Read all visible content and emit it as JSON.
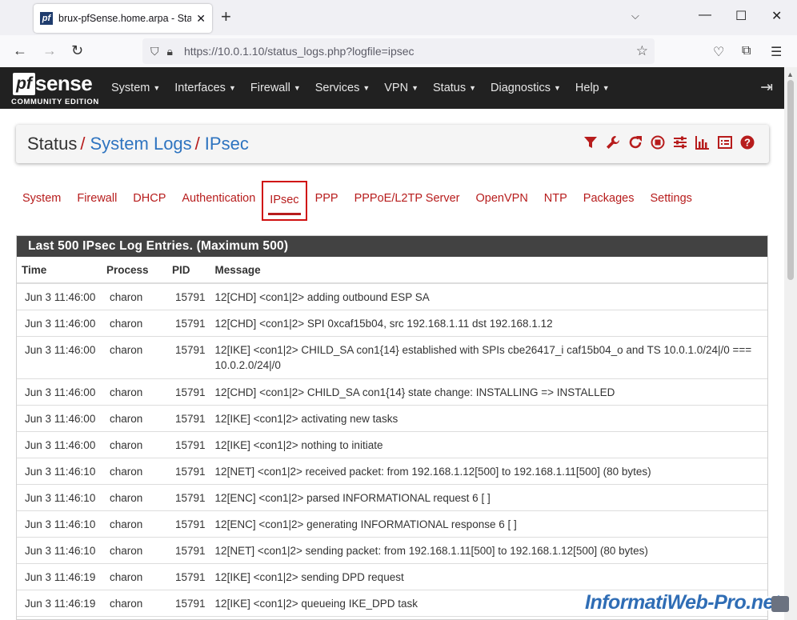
{
  "browser": {
    "tab_title": "brux-pfSense.home.arpa - Status",
    "url_host": "https://10.0.1.10",
    "url_path": "/status_logs.php?logfile=ipsec"
  },
  "nav": {
    "logo_pf": "pf",
    "logo_sense": "sense",
    "logo_edition": "COMMUNITY EDITION",
    "menu": [
      "System",
      "Interfaces",
      "Firewall",
      "Services",
      "VPN",
      "Status",
      "Diagnostics",
      "Help"
    ]
  },
  "breadcrumb": {
    "root": "Status",
    "sep": "/",
    "level1": "System Logs",
    "level2": "IPsec"
  },
  "log_tabs": [
    "System",
    "Firewall",
    "DHCP",
    "Authentication",
    "IPsec",
    "PPP",
    "PPPoE/L2TP Server",
    "OpenVPN",
    "NTP",
    "Packages",
    "Settings"
  ],
  "active_tab": "IPsec",
  "panel": {
    "heading": "Last 500 IPsec Log Entries. (Maximum 500)",
    "columns": [
      "Time",
      "Process",
      "PID",
      "Message"
    ],
    "rows": [
      {
        "time": "Jun 3 11:46:00",
        "process": "charon",
        "pid": "15791",
        "message": "12[CHD] <con1|2> adding outbound ESP SA"
      },
      {
        "time": "Jun 3 11:46:00",
        "process": "charon",
        "pid": "15791",
        "message": "12[CHD] <con1|2> SPI 0xcaf15b04, src 192.168.1.11 dst 192.168.1.12"
      },
      {
        "time": "Jun 3 11:46:00",
        "process": "charon",
        "pid": "15791",
        "message": "12[IKE] <con1|2> CHILD_SA con1{14} established with SPIs cbe26417_i caf15b04_o and TS 10.0.1.0/24|/0 === 10.0.2.0/24|/0"
      },
      {
        "time": "Jun 3 11:46:00",
        "process": "charon",
        "pid": "15791",
        "message": "12[CHD] <con1|2> CHILD_SA con1{14} state change: INSTALLING => INSTALLED"
      },
      {
        "time": "Jun 3 11:46:00",
        "process": "charon",
        "pid": "15791",
        "message": "12[IKE] <con1|2> activating new tasks"
      },
      {
        "time": "Jun 3 11:46:00",
        "process": "charon",
        "pid": "15791",
        "message": "12[IKE] <con1|2> nothing to initiate"
      },
      {
        "time": "Jun 3 11:46:10",
        "process": "charon",
        "pid": "15791",
        "message": "12[NET] <con1|2> received packet: from 192.168.1.12[500] to 192.168.1.11[500] (80 bytes)"
      },
      {
        "time": "Jun 3 11:46:10",
        "process": "charon",
        "pid": "15791",
        "message": "12[ENC] <con1|2> parsed INFORMATIONAL request 6 [ ]"
      },
      {
        "time": "Jun 3 11:46:10",
        "process": "charon",
        "pid": "15791",
        "message": "12[ENC] <con1|2> generating INFORMATIONAL response 6 [ ]"
      },
      {
        "time": "Jun 3 11:46:10",
        "process": "charon",
        "pid": "15791",
        "message": "12[NET] <con1|2> sending packet: from 192.168.1.11[500] to 192.168.1.12[500] (80 bytes)"
      },
      {
        "time": "Jun 3 11:46:19",
        "process": "charon",
        "pid": "15791",
        "message": "12[IKE] <con1|2> sending DPD request"
      },
      {
        "time": "Jun 3 11:46:19",
        "process": "charon",
        "pid": "15791",
        "message": "12[IKE] <con1|2> queueing IKE_DPD task"
      }
    ]
  },
  "watermark": "InformatiWeb-Pro.net",
  "icons": [
    "filter-icon",
    "wrench-icon",
    "refresh-icon",
    "stop-icon",
    "sliders-icon",
    "chart-icon",
    "list-icon",
    "help-icon"
  ],
  "colors": {
    "accent": "#b71c1c",
    "link": "#2e74c0",
    "navbar": "#212121"
  }
}
